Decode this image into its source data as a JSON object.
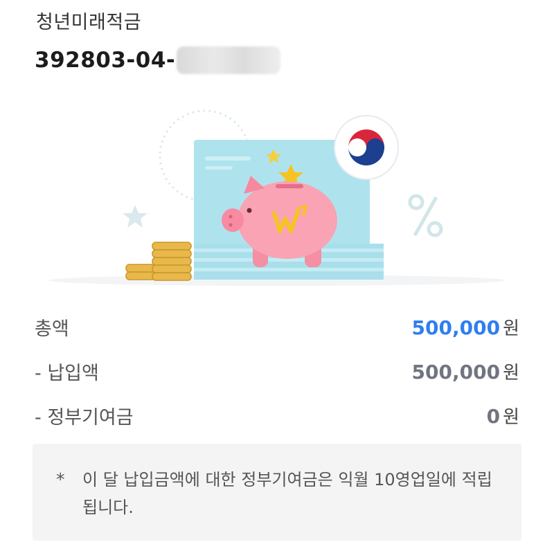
{
  "account": {
    "product_name": "청년미래적금",
    "number_visible": "392803-04-"
  },
  "summary": {
    "total": {
      "label": "총액",
      "amount": "500,000",
      "unit": "원"
    },
    "paid": {
      "label": "- 납입액",
      "amount": "500,000",
      "unit": "원"
    },
    "contribution": {
      "label": "- 정부기여금",
      "amount": "0",
      "unit": "원"
    }
  },
  "notice": {
    "mark": "*",
    "text": "이 달 납입금액에 대한 정부기여금은 익월 10영업일에 적립됩니다."
  },
  "colors": {
    "accent_blue": "#2f7ef0",
    "amount_gray": "#707580",
    "notice_bg": "#f4f4f4",
    "piggy_pink": "#f9a3b4",
    "board_blue": "#aee3ee",
    "coin_gold": "#e8b94a"
  },
  "icons": [
    "piggy-bank-icon",
    "taegeuk-emblem-icon",
    "percent-icon",
    "star-icon",
    "coin-stack-icon"
  ]
}
